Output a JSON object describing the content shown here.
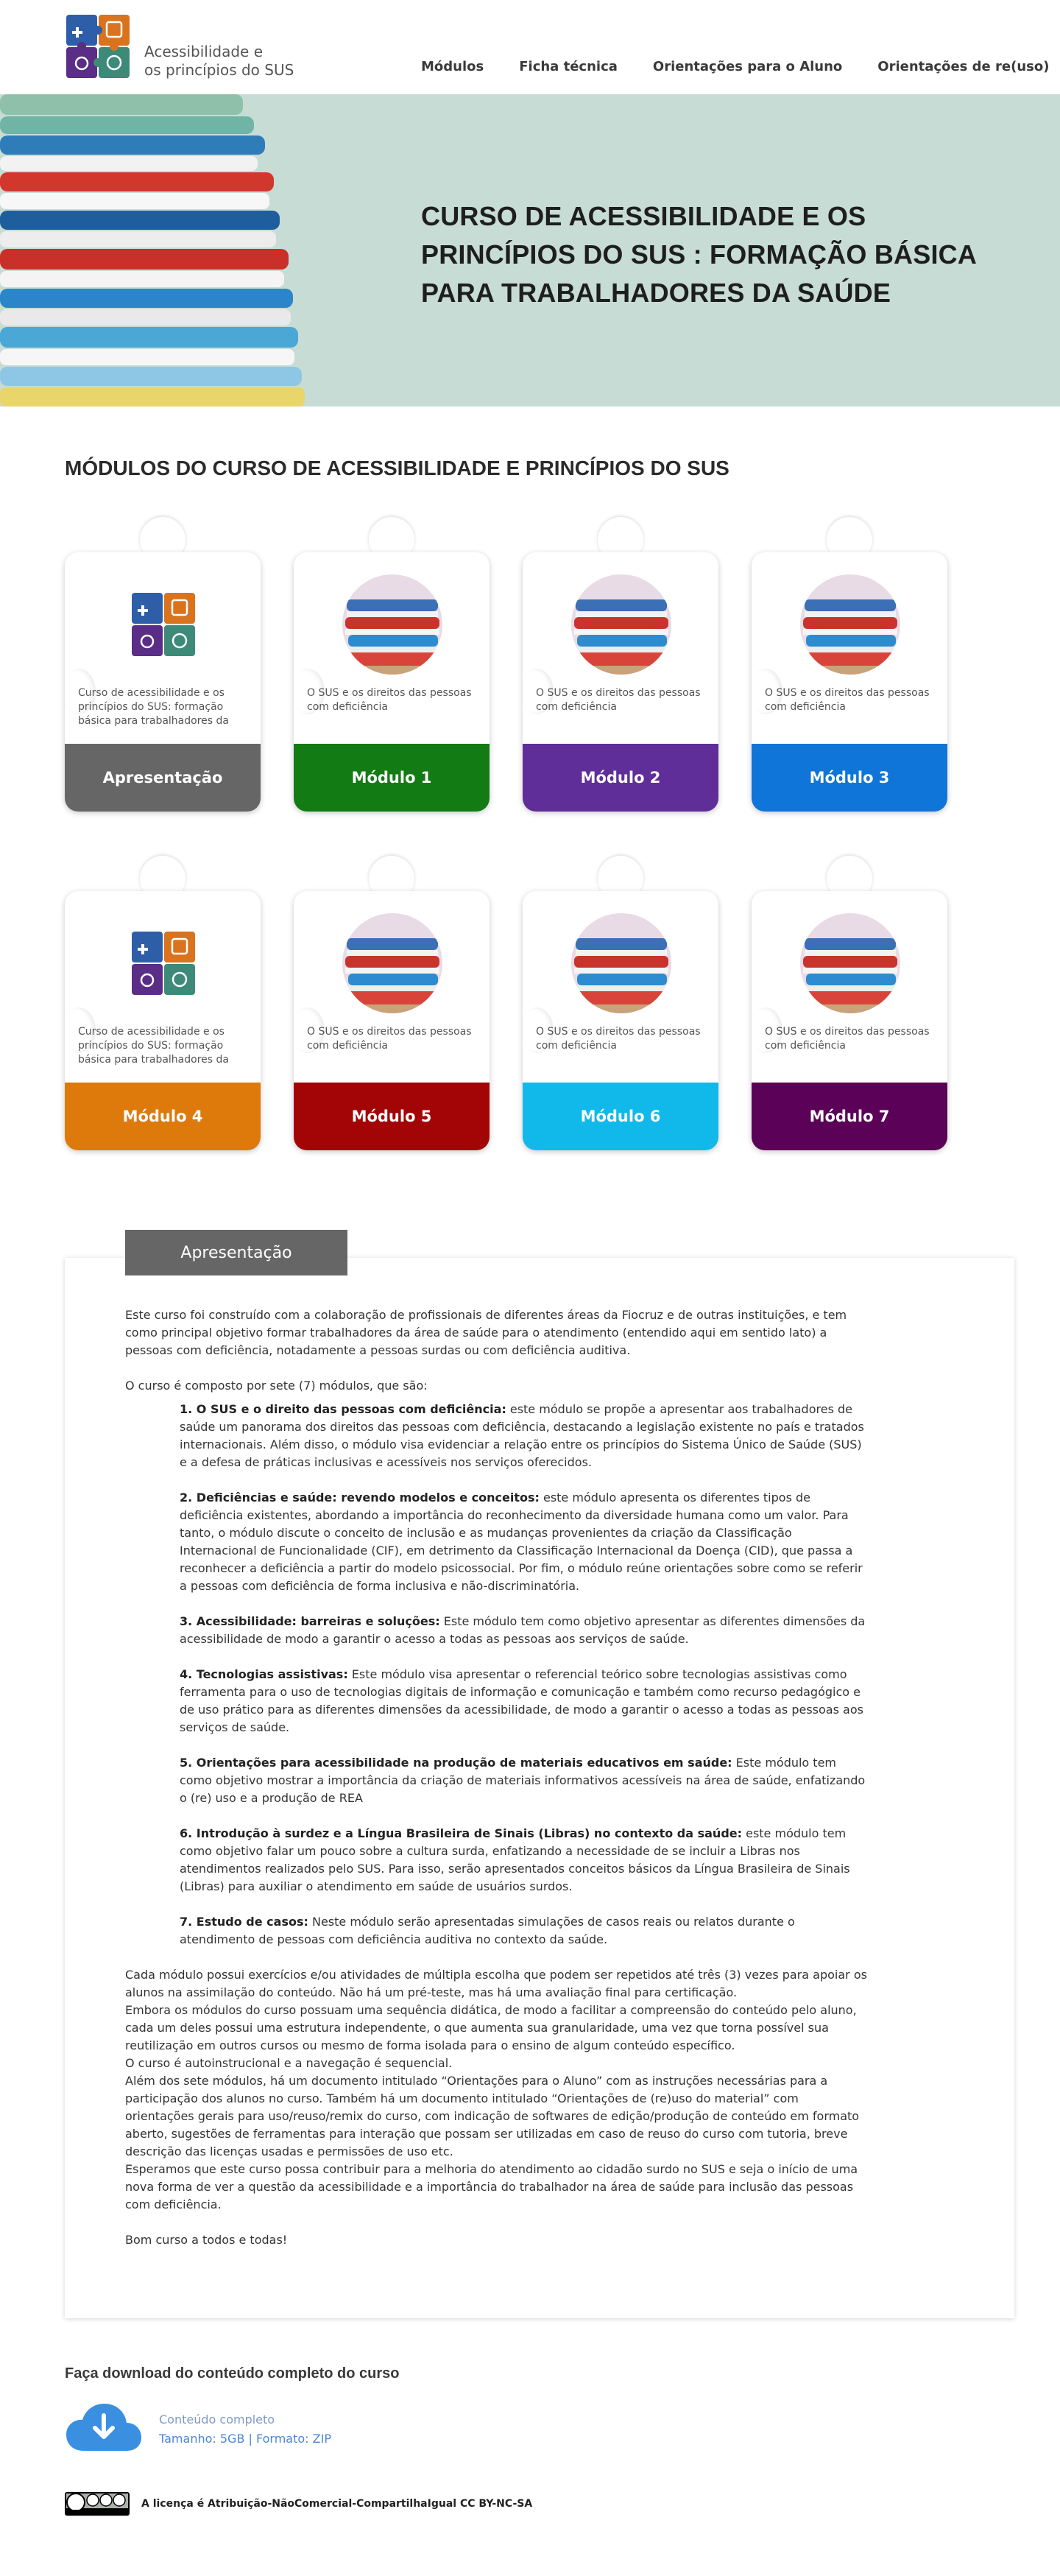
{
  "header": {
    "title_line1": "Acessibilidade e",
    "title_line2": "os princípios do SUS",
    "nav": [
      "Módulos",
      "Ficha técnica",
      "Orientações para o Aluno",
      "Orientações de re(uso)"
    ]
  },
  "hero": {
    "title": "CURSO DE ACESSIBILIDADE E OS PRINCÍPIOS DO SUS : FORMAÇÃO BÁSICA PARA TRABALHADORES DA SAÚDE"
  },
  "modules": {
    "section_title": "MÓDULOS DO CURSO DE ACESSIBILIDADE E PRINCÍPIOS DO SUS",
    "cards": [
      {
        "label": "Apresentação",
        "desc": "Curso de acessibilidade e os princípios do SUS: formação básica para trabalhadores da saúde",
        "color": "#666666",
        "image": "puzzle-logo"
      },
      {
        "label": "Módulo 1",
        "desc": "O SUS e os direitos das pessoas com deficiência",
        "color": "#137b13",
        "image": "books-photo"
      },
      {
        "label": "Módulo 2",
        "desc": "O SUS e os direitos das pessoas com deficiência",
        "color": "#5f2e99",
        "image": "books-photo"
      },
      {
        "label": "Módulo 3",
        "desc": "O SUS e os direitos das pessoas com deficiência",
        "color": "#1075d8",
        "image": "books-photo"
      },
      {
        "label": "Módulo 4",
        "desc": "Curso de acessibilidade e os princípios do SUS: formação básica para trabalhadores da saúde",
        "color": "#de7a0c",
        "image": "puzzle-logo"
      },
      {
        "label": "Módulo 5",
        "desc": "O SUS e os direitos das pessoas com deficiência",
        "color": "#a30406",
        "image": "books-photo"
      },
      {
        "label": "Módulo 6",
        "desc": "O SUS e os direitos das pessoas com deficiência",
        "color": "#10b9ea",
        "image": "books-photo"
      },
      {
        "label": "Módulo 7",
        "desc": "O SUS e os direitos das pessoas com deficiência",
        "color": "#5b0157",
        "image": "books-photo"
      }
    ]
  },
  "presentation": {
    "tab_label": "Apresentação",
    "intro": "Este curso foi construído com a colaboração de profissionais de diferentes áreas da Fiocruz e de outras instituições, e tem como principal objetivo formar trabalhadores da área de saúde para o atendimento (entendido aqui em sentido lato) a pessoas com deficiência, notadamente a pessoas surdas ou com deficiência auditiva.",
    "composition": "O curso é composto por sete (7) módulos, que são:",
    "items": [
      {
        "title": "1. O SUS e o direito das pessoas com deficiência:",
        "text": " este módulo se propõe a apresentar aos trabalhadores de saúde um panorama dos direitos das pessoas com deficiência, destacando a legislação existente no país e tratados internacionais. Além disso, o módulo visa evidenciar a relação entre os princípios do Sistema Único de Saúde (SUS) e a defesa de práticas inclusivas e acessíveis nos serviços oferecidos."
      },
      {
        "title": "2. Deficiências e saúde: revendo modelos e conceitos:",
        "text": " este módulo apresenta os diferentes tipos de deficiência existentes, abordando a importância do reconhecimento da diversidade humana como um valor. Para tanto, o módulo discute o conceito de inclusão e as mudanças provenientes da criação da Classificação Internacional de Funcionalidade (CIF), em detrimento da Classificação Internacional da Doença (CID), que passa a reconhecer a deficiência a partir do modelo psicossocial. Por fim, o módulo reúne orientações sobre como se referir a pessoas com deficiência de forma inclusiva e não-discriminatória."
      },
      {
        "title": "3. Acessibilidade: barreiras e soluções:",
        "text": " Este módulo tem como objetivo apresentar as diferentes dimensões da acessibilidade de modo a garantir o acesso a todas as pessoas aos serviços de saúde."
      },
      {
        "title": "4. Tecnologias assistivas:",
        "text": " Este módulo visa apresentar o referencial teórico sobre tecnologias assistivas como ferramenta para o uso de tecnologias digitais de informação e comunicação e também como recurso pedagógico e de uso prático para as diferentes dimensões da acessibilidade, de modo a garantir o acesso a todas as pessoas aos serviços de saúde."
      },
      {
        "title": "5. Orientações para acessibilidade na produção de materiais educativos em saúde:",
        "text": " Este módulo tem como objetivo mostrar a importância da criação de materiais informativos acessíveis na área de saúde, enfatizando o (re) uso e a produção de REA"
      },
      {
        "title": "6. Introdução à surdez e a Língua Brasileira de Sinais (Libras) no contexto da saúde:",
        "text": " este módulo tem como objetivo falar um pouco sobre a cultura surda, enfatizando a necessidade de se incluir a Libras nos atendimentos realizados pelo SUS. Para isso, serão apresentados conceitos básicos da Língua Brasileira de Sinais (Libras) para auxiliar o atendimento em saúde de usuários surdos."
      },
      {
        "title": "7. Estudo de casos:",
        "text": " Neste módulo serão apresentadas simulações de casos reais ou relatos durante o atendimento de pessoas com deficiência auditiva no contexto da saúde."
      }
    ],
    "closing": [
      "Cada módulo possui exercícios e/ou atividades de múltipla escolha que podem ser repetidos até três (3) vezes para apoiar os alunos na assimilação do conteúdo. Não há um pré-teste, mas há uma avaliação final para certificação.",
      "Embora os módulos do curso possuam uma sequência didática, de modo a facilitar a compreensão do conteúdo pelo aluno, cada um deles possui uma estrutura independente, o que aumenta sua granularidade, uma vez que torna possível sua reutilização em outros cursos ou mesmo de forma isolada para o ensino de algum conteúdo específico.",
      "O curso é autoinstrucional e a navegação é sequencial.",
      "Além dos sete módulos, há um documento intitulado “Orientações para o Aluno” com as instruções necessárias para a participação dos alunos no curso. Também há um documento intitulado “Orientações de (re)uso do material” com orientações gerais para uso/reuso/remix do curso, com indicação de softwares de edição/produção de conteúdo em formato aberto, sugestões de ferramentas para interação que possam ser utilizadas em caso de reuso do curso com tutoria, breve descrição das licenças usadas e permissões de uso etc.",
      "Esperamos que este curso possa contribuir para a melhoria do atendimento ao cidadão surdo no SUS e seja o início de uma nova forma de ver a questão da acessibilidade e a importância do trabalhador na área de saúde para inclusão das pessoas com deficiência."
    ],
    "farewell": "Bom curso a todos e todas!"
  },
  "download": {
    "title": "Faça download do conteúdo completo do curso",
    "name": "Conteúdo completo",
    "info": "Tamanho: 5GB | Formato: ZIP"
  },
  "license": {
    "text": "A licença é Atribuição-NãoComercial-CompartilhaIgual CC BY-NC-SA"
  }
}
